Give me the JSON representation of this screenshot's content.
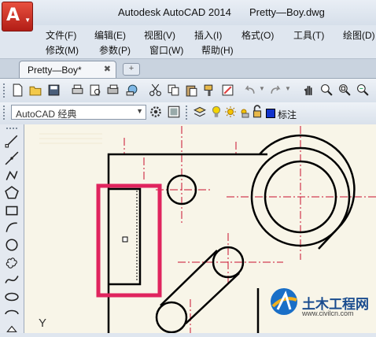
{
  "window": {
    "app_title": "Autodesk AutoCAD 2014",
    "file_title": "Pretty—Boy.dwg"
  },
  "app_button": {
    "letter": "A"
  },
  "menu": {
    "row1": [
      "文件(F)",
      "编辑(E)",
      "视图(V)",
      "插入(I)",
      "格式(O)",
      "工具(T)",
      "绘图(D)"
    ],
    "row2": [
      "修改(M)",
      "参数(P)",
      "窗口(W)",
      "帮助(H)"
    ]
  },
  "tabs": {
    "active_label": "Pretty—Boy*",
    "close_symbol": "✖"
  },
  "workspace": {
    "selected": "AutoCAD 经典"
  },
  "layer": {
    "name": "标注"
  },
  "ucs": {
    "y_label": "Y"
  },
  "watermark": {
    "text": "土木工程网",
    "url": "www.civilcn.com"
  },
  "colors": {
    "highlight": "#e0245e",
    "canvas": "#f8f5e8",
    "app_red": "#c62b22"
  },
  "icons": {
    "toolbar": [
      "new-icon",
      "open-icon",
      "save-icon",
      "plot-icon",
      "plot-preview-icon",
      "publish-icon",
      "3d-print-icon",
      "cut-icon",
      "copy-icon",
      "paste-icon",
      "match-properties-icon",
      "block-editor-icon",
      "undo-icon",
      "redo-icon",
      "pan-icon",
      "zoom-realtime-icon",
      "zoom-window-icon",
      "zoom-previous-icon"
    ],
    "left": [
      "line-icon",
      "construction-line-icon",
      "polyline-icon",
      "polygon-icon",
      "rectangle-icon",
      "arc-icon",
      "circle-icon",
      "revision-cloud-icon",
      "spline-icon",
      "ellipse-icon",
      "ellipse-arc-icon",
      "insert-block-icon"
    ]
  }
}
